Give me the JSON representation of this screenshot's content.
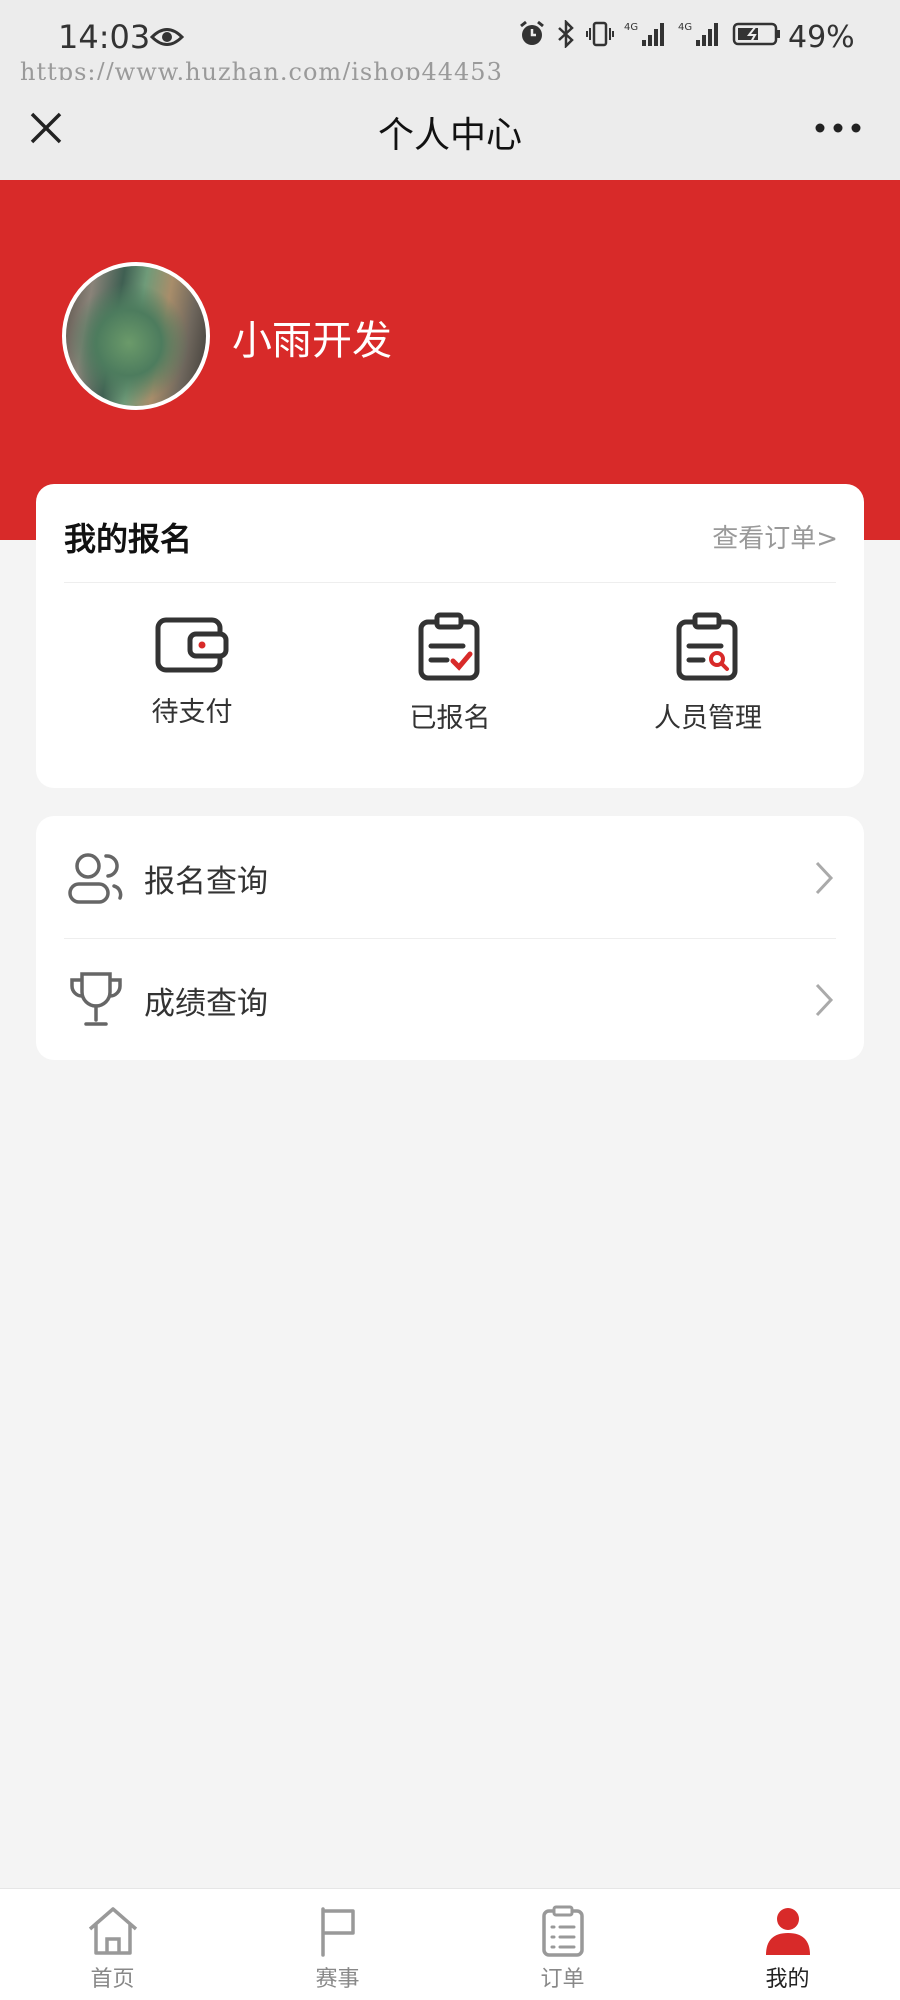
{
  "status_bar": {
    "time": "14:03",
    "battery": "49%",
    "watermark": "https://www.huzhan.com/ishop44453"
  },
  "nav": {
    "title": "个人中心"
  },
  "profile": {
    "username": "小雨开发"
  },
  "registration": {
    "title": "我的报名",
    "view_orders": "查看订单>",
    "items": [
      {
        "label": "待支付",
        "icon": "wallet-icon"
      },
      {
        "label": "已报名",
        "icon": "clipboard-check-icon"
      },
      {
        "label": "人员管理",
        "icon": "clipboard-search-icon"
      }
    ]
  },
  "menu": {
    "items": [
      {
        "label": "报名查询",
        "icon": "users-icon"
      },
      {
        "label": "成绩查询",
        "icon": "trophy-icon"
      }
    ]
  },
  "tabs": [
    {
      "label": "首页",
      "icon": "home-icon"
    },
    {
      "label": "赛事",
      "icon": "flag-icon"
    },
    {
      "label": "订单",
      "icon": "list-icon"
    },
    {
      "label": "我的",
      "icon": "user-icon"
    }
  ],
  "colors": {
    "accent": "#d82a29",
    "background": "#f4f4f4",
    "nav_background": "#ececec"
  }
}
